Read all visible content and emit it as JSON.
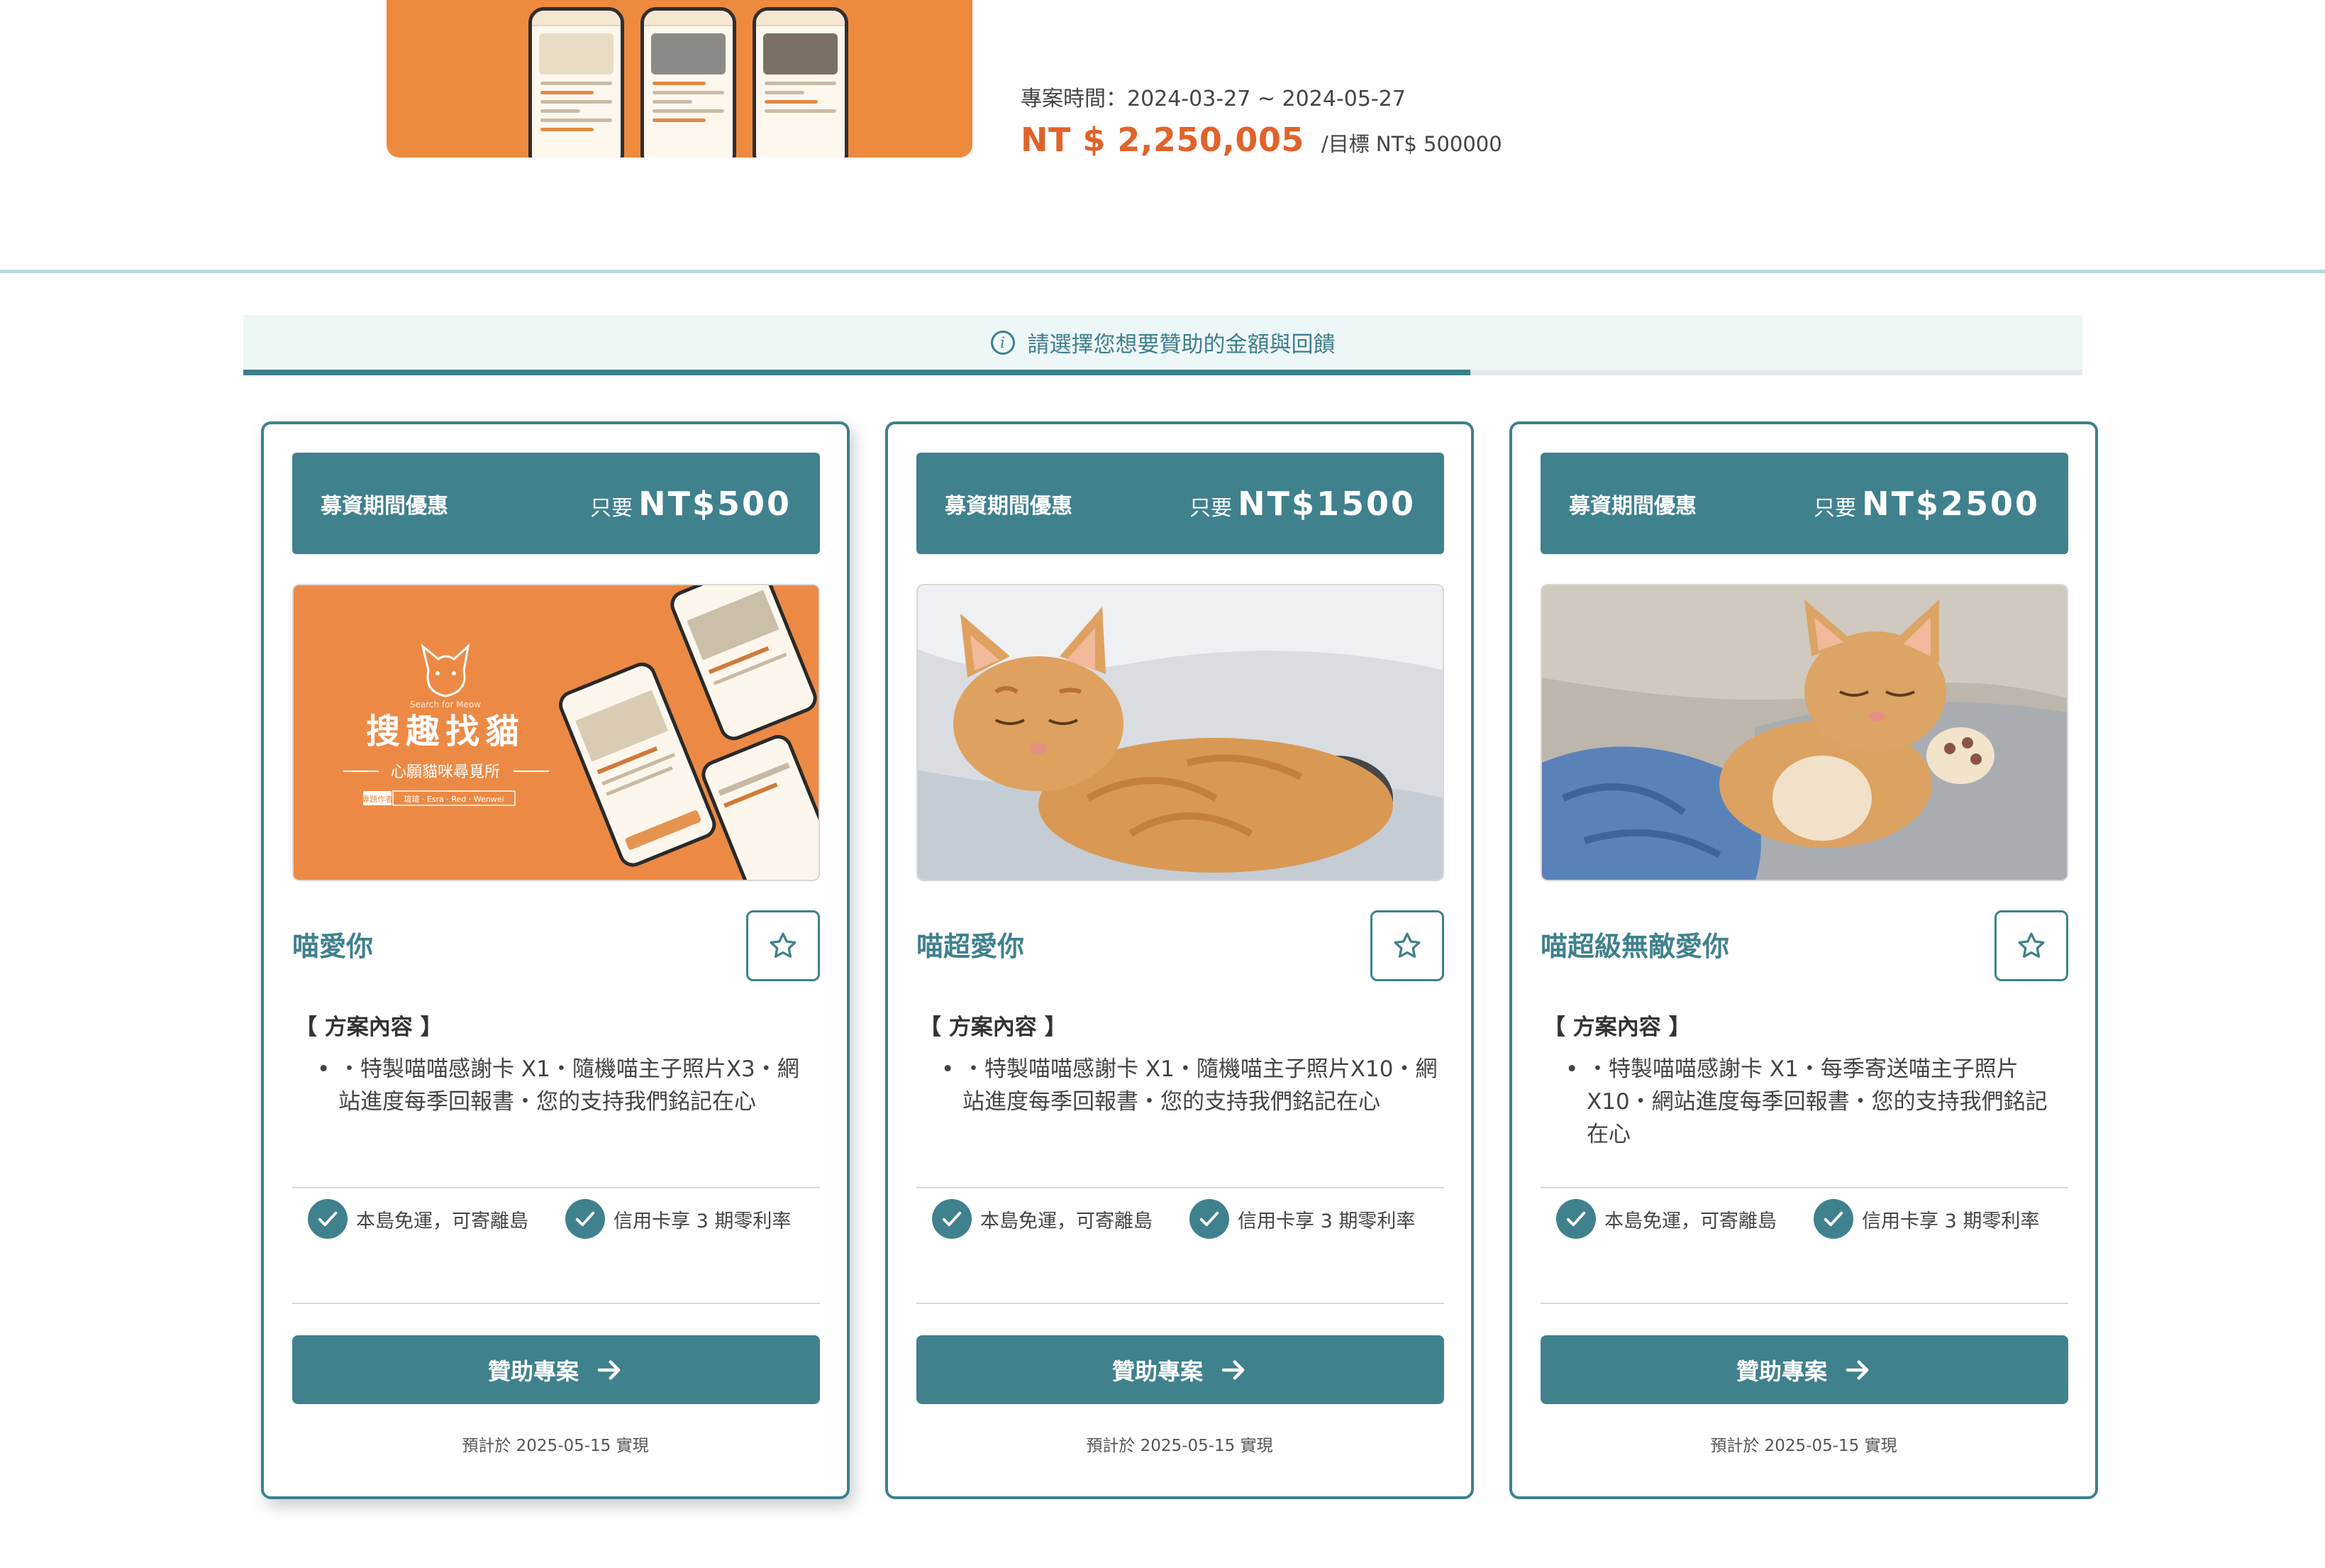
{
  "project": {
    "date_label": "專案時間：2024-03-27 ~ 2024-05-27",
    "raised": "NT $ 2,250,005",
    "goal": "/目標 NT$ 500000"
  },
  "notice": {
    "icon": "info-icon",
    "text": "請選擇您想要贊助的金額與回饋",
    "progress": 0.667
  },
  "colors": {
    "accent": "#3f818d",
    "orange": "#e0632a",
    "hero_bg": "#ee8a3e"
  },
  "cards": [
    {
      "promo": "募資期間優惠",
      "only": "只要",
      "price": "NT$500",
      "title": "喵愛你",
      "plan_label": "【 方案內容 】",
      "plan_text": "・特製喵喵感謝卡 X1・隨機喵主子照片X3・網站進度每季回報書・您的支持我們銘記在心",
      "image": {
        "title": "搜趣找貓",
        "brand": "Search for Meow",
        "subtitle": "心願貓咪尋覓所",
        "credit_label": "專題作者",
        "credit_names": "瑄瑄 · Esra · Red · Wenwei"
      }
    },
    {
      "promo": "募資期間優惠",
      "only": "只要",
      "price": "NT$1500",
      "title": "喵超愛你",
      "plan_label": "【 方案內容 】",
      "plan_text": "・特製喵喵感謝卡 X1・隨機喵主子照片X10・網站進度每季回報書・您的支持我們銘記在心"
    },
    {
      "promo": "募資期間優惠",
      "only": "只要",
      "price": "NT$2500",
      "title": "喵超級無敵愛你",
      "plan_label": "【 方案內容 】",
      "plan_text": "・特製喵喵感謝卡 X1・每季寄送喵主子照片X10・網站進度每季回報書・您的支持我們銘記在心"
    }
  ],
  "common": {
    "feature_1": "本島免運，可寄離島",
    "feature_2": "信用卡享 3 期零利率",
    "sponsor_label": "贊助專案",
    "eta": "預計於 2025-05-15 實現"
  }
}
